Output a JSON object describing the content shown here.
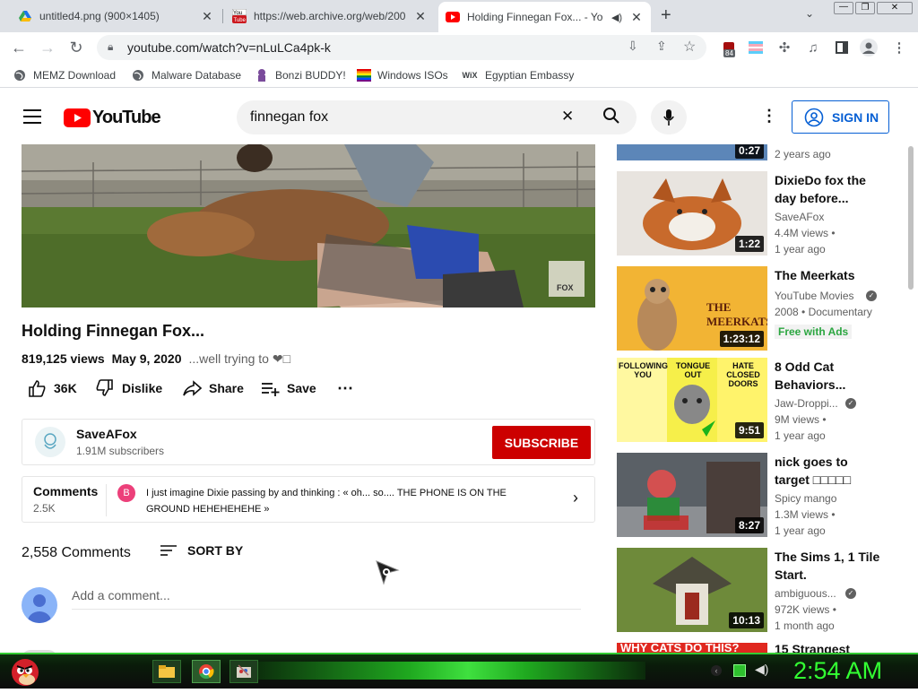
{
  "tabs": [
    {
      "label": "untitled4.png (900×1405)",
      "icon": "drive-icon"
    },
    {
      "label": "https://web.archive.org/web/200",
      "icon": "youtube-old-icon"
    },
    {
      "label": "Holding Finnegan Fox... - Yo",
      "icon": "youtube-icon",
      "active": true
    }
  ],
  "toolbar": {
    "url": "youtube.com/watch?v=nLuLCa4pk-k",
    "extension_badge": "84"
  },
  "bookmarks": [
    {
      "label": "MEMZ Download",
      "icon": "globe-icon"
    },
    {
      "label": "Malware Database",
      "icon": "globe-icon"
    },
    {
      "label": "Bonzi BUDDY!",
      "icon": "bonzi-icon"
    },
    {
      "label": "Windows ISOs",
      "icon": "windows-icon"
    },
    {
      "label": "Egyptian Embassy",
      "icon": "wix-icon"
    }
  ],
  "youtube": {
    "logo_text": "YouTube",
    "search_query": "finnegan fox",
    "sign_in": "SIGN IN"
  },
  "video": {
    "title": "Holding Finnegan Fox...",
    "views": "819,125 views",
    "date": "May 9, 2020",
    "description_snippet": "...well trying to ❤︎□",
    "like_count": "36K",
    "dislike": "Dislike",
    "share": "Share",
    "save": "Save",
    "watermark_text": "FOX"
  },
  "channel": {
    "name": "SaveAFox",
    "subscribers": "1.91M subscribers",
    "subscribe": "SUBSCRIBE"
  },
  "comments_teaser": {
    "label": "Comments",
    "count": "2.5K",
    "avatar_letter": "B",
    "text": "I just imagine Dixie passing by and thinking : « oh... so.... THE PHONE IS ON THE GROUND HEHEHEHEHE »"
  },
  "comments": {
    "count_label": "2,558 Comments",
    "sort_by": "SORT BY",
    "add_placeholder": "Add a comment..."
  },
  "sidebar": [
    {
      "title": "",
      "channel": "",
      "meta1": "2 years ago",
      "meta2": "",
      "duration": "0:27"
    },
    {
      "title": "DixieDo fox the day before...",
      "channel": "SaveAFox",
      "meta1": "4.4M views •",
      "meta2": "1 year ago",
      "duration": "1:22"
    },
    {
      "title": "The Meerkats",
      "channel": "YouTube Movies",
      "meta1": "2008 • Documentary",
      "meta2": "Free with Ads",
      "duration": "1:23:12",
      "thumb_text": "THE MEERKATS"
    },
    {
      "title": "8 Odd Cat Behaviors...",
      "channel": "Jaw-Droppi...",
      "meta1": "9M views •",
      "meta2": "1 year ago",
      "duration": "9:51",
      "thumb_labels": [
        "FOLLOWING YOU",
        "TONGUE OUT",
        "HATE CLOSED DOORS"
      ]
    },
    {
      "title": "nick goes to target □□□□□",
      "channel": "Spicy mango",
      "meta1": "1.3M views •",
      "meta2": "1 year ago",
      "duration": "8:27"
    },
    {
      "title": "The Sims 1, 1 Tile Start.",
      "channel": "ambiguous...",
      "meta1": "972K views •",
      "meta2": "1 month ago",
      "duration": "10:13"
    },
    {
      "title": "15 Strangest",
      "thumb_text": "WHY CATS DO THIS?"
    }
  ],
  "taskbar": {
    "clock": "2:54 AM"
  },
  "colors": {
    "youtube_red": "#ff0000",
    "subscribe_red": "#cc0000",
    "link_blue": "#065fd4",
    "free_green": "#2ba640",
    "taskbar_green": "#33cc33"
  }
}
